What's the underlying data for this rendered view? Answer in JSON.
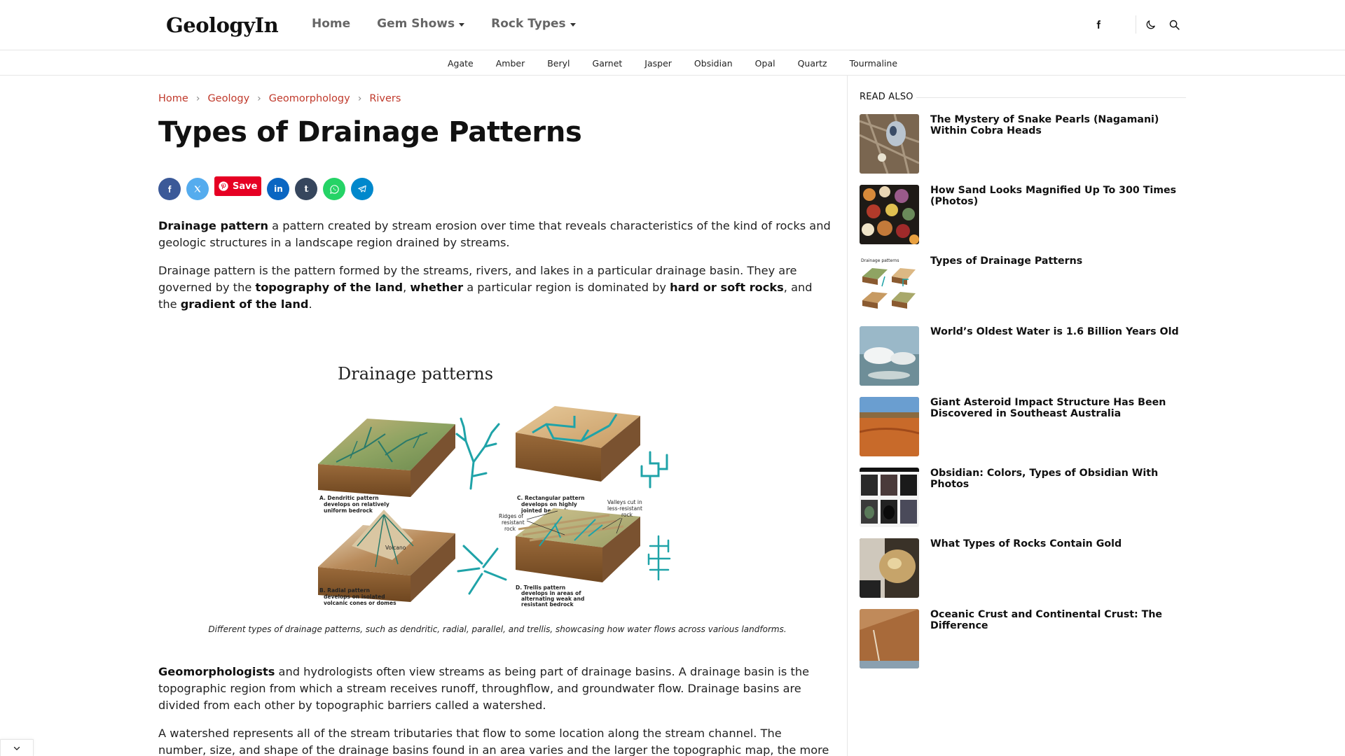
{
  "header": {
    "logo": "GeologyIn",
    "nav": [
      {
        "label": "Home"
      },
      {
        "label": "Gem Shows"
      },
      {
        "label": "Rock Types"
      }
    ],
    "icons": [
      "facebook-icon",
      "moon-icon",
      "search-icon"
    ]
  },
  "subnav": [
    "Agate",
    "Amber",
    "Beryl",
    "Garnet",
    "Jasper",
    "Obsidian",
    "Opal",
    "Quartz",
    "Tourmaline"
  ],
  "breadcrumb": [
    "Home",
    "Geology",
    "Geomorphology",
    "Rivers"
  ],
  "article": {
    "title": "Types of Drainage Patterns",
    "share": {
      "save_label": "Save",
      "colors": {
        "facebook": "#3b5998",
        "x": "#55acee",
        "pinterest": "#e60023",
        "linkedin": "#0a66c2",
        "tumblr": "#36465d",
        "whatsapp": "#25d366",
        "telegram": "#0088cc"
      }
    },
    "p1_bold": "Drainage pattern",
    "p1_rest": " a pattern created by stream erosion over time that reveals characteristics of the kind of rocks and geologic structures in a landscape region drained by streams.",
    "p2_a": "Drainage pattern is the pattern formed by the streams, rivers, and lakes in a particular drainage basin. They are governed by the ",
    "p2_b1": "topography of the land",
    "p2_c": ", ",
    "p2_b2": "whether",
    "p2_d": " a particular region is dominated by ",
    "p2_b3": "hard or soft rocks",
    "p2_e": ", and the ",
    "p2_b4": "gradient of the land",
    "p2_f": ".",
    "figure": {
      "heading": "Drainage patterns",
      "labels": {
        "a": [
          "A. Dendritic pattern",
          "develops on relatively",
          "uniform bedrock"
        ],
        "b": [
          "B. Radial pattern",
          "develops on isolated",
          "volcanic cones or domes"
        ],
        "c": [
          "C. Rectangular pattern",
          "develops on highly",
          "jointed bedrock"
        ],
        "d": [
          "D. Trellis pattern",
          "develops in areas of",
          "alternating weak and",
          "resistant bedrock"
        ],
        "volcano": "Volcano",
        "ridges": [
          "Ridges of",
          "resistant",
          "rock"
        ],
        "valleys": [
          "Valleys cut in",
          "less-resistant",
          "rock"
        ]
      },
      "caption": "Different types of drainage patterns, such as dendritic, radial, parallel, and trellis, showcasing how water flows across various landforms."
    },
    "p3_bold": "Geomorphologists",
    "p3_rest": " and hydrologists often view streams as being part of drainage basins. A drainage basin is the topographic region from which a stream receives runoff, throughflow, and groundwater flow. Drainage basins are divided from each other by topographic barriers called a watershed.",
    "p4": "A watershed represents all of the stream tributaries that flow to some location along the stream channel. The number, size, and shape of the drainage basins found in an area varies and the larger the topographic map, the more"
  },
  "sidebar": {
    "heading": "READ ALSO",
    "items": [
      {
        "title": "The Mystery of Snake Pearls (Nagamani) Within Cobra Heads"
      },
      {
        "title": "How Sand Looks Magnified Up To 300 Times (Photos)"
      },
      {
        "title": "Types of Drainage Patterns",
        "thumb_text": "Drainage patterns"
      },
      {
        "title": "World’s Oldest Water is 1.6 Billion Years Old"
      },
      {
        "title": "Giant Asteroid Impact Structure Has Been Discovered in Southeast Australia"
      },
      {
        "title": "Obsidian: Colors, Types of Obsidian With Photos"
      },
      {
        "title": "What Types of Rocks Contain Gold"
      },
      {
        "title": "Oceanic Crust and Continental Crust: The Difference"
      }
    ]
  },
  "colors": {
    "link": "#c0392b",
    "water": "#1fa3a8"
  }
}
